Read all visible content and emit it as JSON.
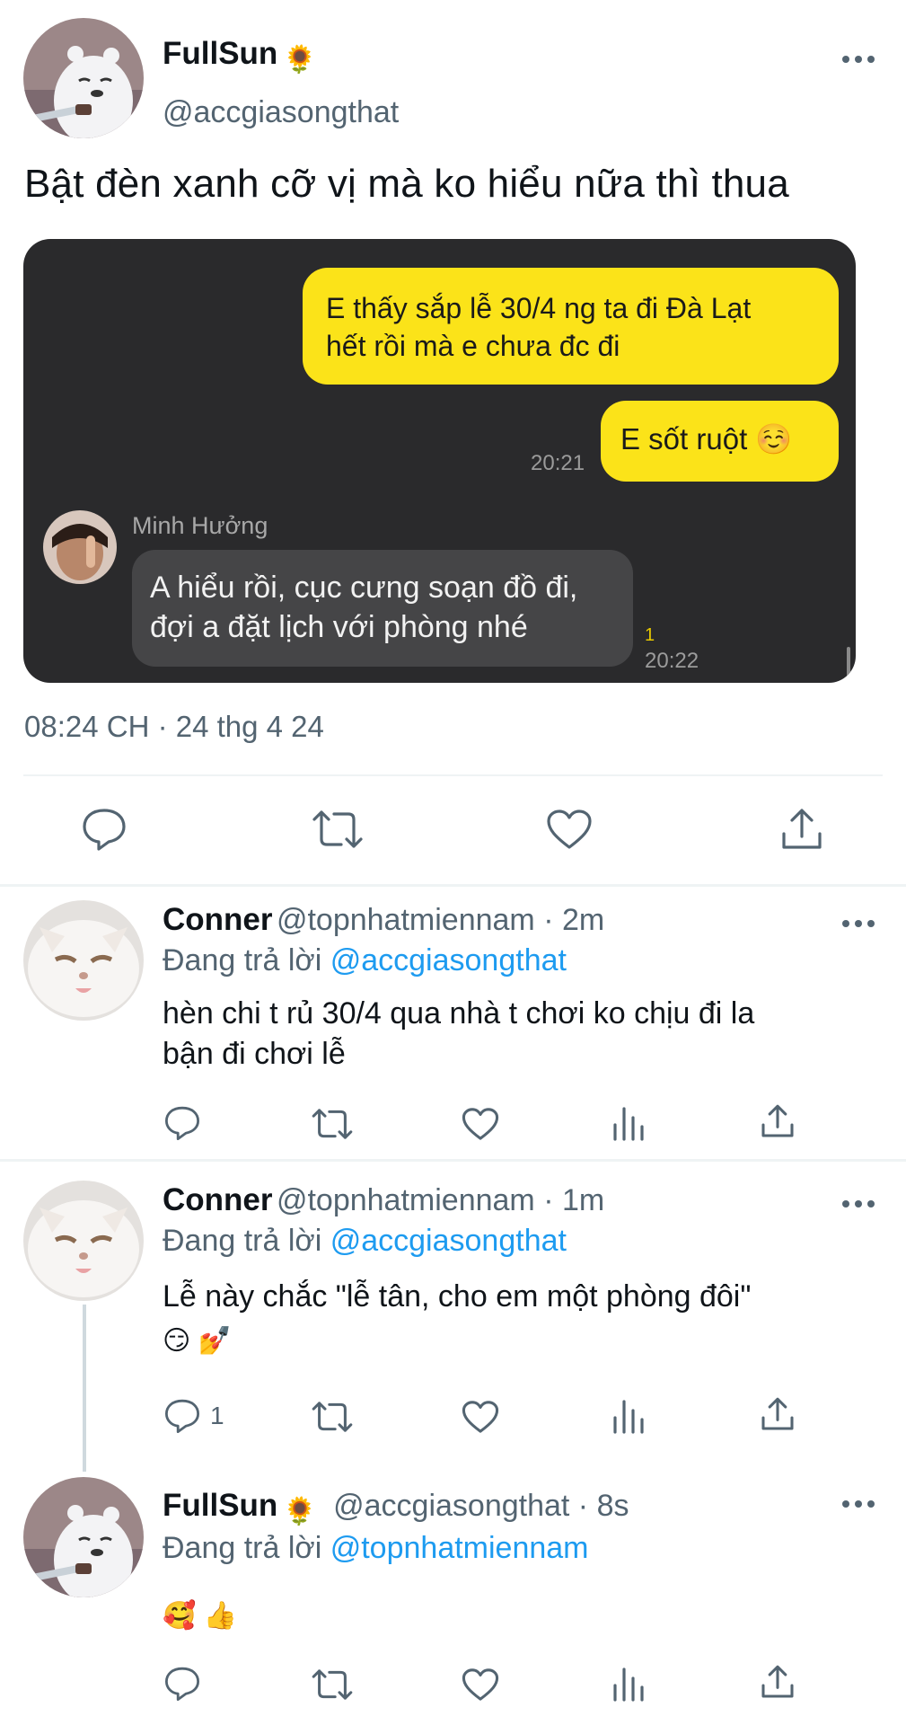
{
  "main_tweet": {
    "author_name": "FullSun",
    "author_emoji": "🌻",
    "handle": "@accgiasongthat",
    "text": "Bật đèn xanh cỡ vị mà ko hiểu nữa thì thua",
    "timestamp": "08:24 CH · 24 thg 4 24",
    "chat": {
      "msg1_line1": "E thấy sắp lễ 30/4 ng ta đi Đà Lạt",
      "msg1_line2": "hết rồi mà e chưa đc đi",
      "msg2": "E sốt ruột ☺️",
      "msg2_time": "20:21",
      "sender": "Minh Hưởng",
      "reply_line1": "A hiểu rồi, cục cưng soạn đồ đi,",
      "reply_line2": "đợi a đặt lịch với phòng nhé",
      "reply_unread": "1",
      "reply_time": "20:22"
    }
  },
  "replies": [
    {
      "author_name": "Conner",
      "meta": "@topnhatmiennam · 2m",
      "reply_label": "Đang trả lời",
      "reply_target": "@accgiasongthat",
      "text_line1": "hèn chi t rủ 30/4 qua nhà t chơi ko chịu đi la",
      "text_line2": "bận đi chơi lễ"
    },
    {
      "author_name": "Conner",
      "meta": "@topnhatmiennam · 1m",
      "reply_label": "Đang trả lời",
      "reply_target": "@accgiasongthat",
      "text_line1": "Lễ này chắc \"lễ tân, cho em một phòng đôi\"",
      "text_line2": "😏 💅",
      "reply_count": "1"
    },
    {
      "author_name": "FullSun",
      "author_emoji": "🌻",
      "meta": "@accgiasongthat · 8s",
      "reply_label": "Đang trả lời",
      "reply_target": "@topnhatmiennam",
      "text_line1": "🥰 👍"
    }
  ],
  "icons": {
    "reply": "reply-icon",
    "retweet": "retweet-icon",
    "like": "heart-icon",
    "views": "views-icon",
    "share": "share-icon",
    "more": "more-icon"
  },
  "colors": {
    "link": "#1d9bf0",
    "secondary_text": "#536471",
    "chat_background": "#2a2a2c",
    "chat_bubble_outgoing": "#fbe319",
    "chat_bubble_incoming": "#454547"
  }
}
